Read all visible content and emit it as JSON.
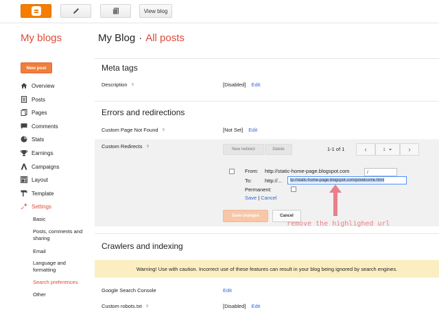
{
  "toolbar": {
    "view_blog": "View blog",
    "icons": [
      "blogger-icon",
      "pencil-icon",
      "pages-icon"
    ]
  },
  "header": {
    "my_blogs": "My blogs",
    "blog_name": "My Blog",
    "separator": "·",
    "current": "All posts"
  },
  "sidebar": {
    "new_post": "New post",
    "items": [
      {
        "label": "Overview",
        "icon": "home-icon"
      },
      {
        "label": "Posts",
        "icon": "posts-icon"
      },
      {
        "label": "Pages",
        "icon": "pages-icon"
      },
      {
        "label": "Comments",
        "icon": "comment-icon"
      },
      {
        "label": "Stats",
        "icon": "stats-icon"
      },
      {
        "label": "Earnings",
        "icon": "trophy-icon"
      },
      {
        "label": "Campaigns",
        "icon": "campaigns-icon"
      },
      {
        "label": "Layout",
        "icon": "layout-icon"
      },
      {
        "label": "Template",
        "icon": "template-icon"
      },
      {
        "label": "Settings",
        "icon": "wrench-icon",
        "active": true
      }
    ],
    "sub_items": [
      {
        "label": "Basic"
      },
      {
        "label": "Posts, comments and sharing"
      },
      {
        "label": "Email"
      },
      {
        "label": "Language and formatting"
      },
      {
        "label": "Search preferences",
        "active": true
      },
      {
        "label": "Other"
      }
    ]
  },
  "meta_tags": {
    "title": "Meta tags",
    "description_label": "Description",
    "help": "?",
    "description_value": "[Disabled]",
    "edit": "Edit"
  },
  "errors": {
    "title": "Errors and redirections",
    "not_found_label": "Custom Page Not Found",
    "not_found_value": "[Not Set]",
    "edit": "Edit",
    "redirects_label": "Custom Redirects",
    "help": "?",
    "new_redirect": "New redirect",
    "delete": "Delete",
    "range": "1-1 of 1",
    "page_select": "1",
    "prev": "‹",
    "next": "›",
    "from_label": "From:",
    "from_url": "http://static-home-page.blogspot.com",
    "from_value": "/",
    "to_label": "To:",
    "to_prefix": "http://...",
    "to_value": "tp://static-home-page.blogspot.com/p/welcome.html",
    "permanent_label": "Permanent:",
    "save": "Save",
    "pipe": "|",
    "cancel": "Cancel",
    "save_changes": "Save changes",
    "cancel_btn": "Cancel"
  },
  "annotation": {
    "note": "remove the highlighed url",
    "color": "#e8808a"
  },
  "crawlers": {
    "title": "Crawlers and indexing",
    "warning": "Warning! Use with caution. Incorrect use of these features can result in your blog being ignored by search engines.",
    "gsc_label": "Google Search Console",
    "gsc_edit": "Edit",
    "robots_label": "Custom robots.txt",
    "help": "?",
    "robots_value": "[Disabled]",
    "robots_edit": "Edit"
  },
  "colors": {
    "accent": "#dd4b39",
    "brand": "#f57d00",
    "link": "#3367d6",
    "warning_bg": "#fbefc2"
  }
}
